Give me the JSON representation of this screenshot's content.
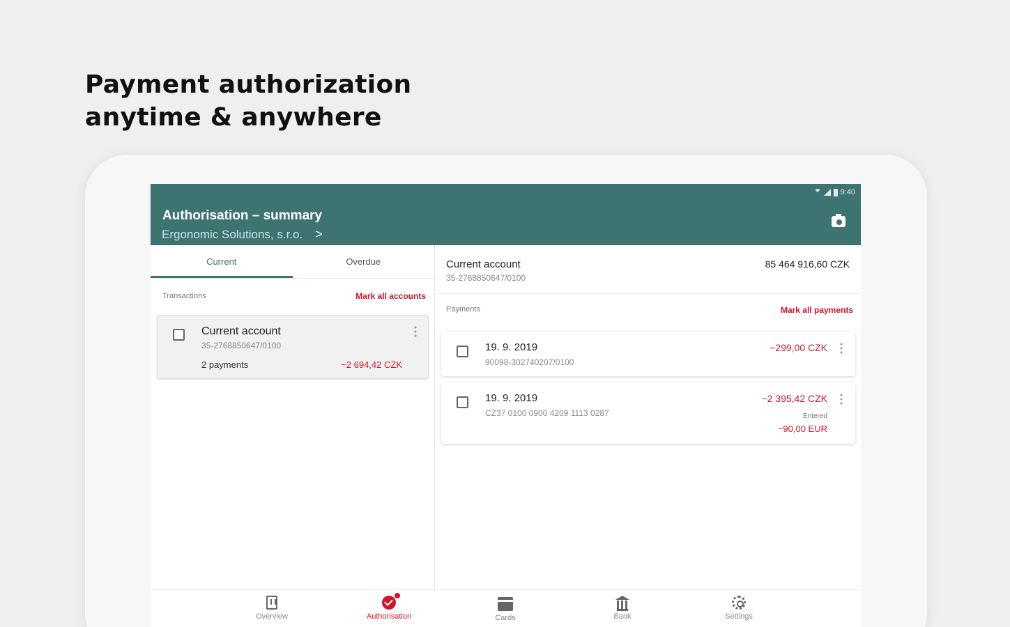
{
  "headline": {
    "line1": "Payment authorization",
    "line2": "anytime & anywhere"
  },
  "status_bar": {
    "time": "9:40"
  },
  "app_bar": {
    "title": "Authorisation – summary",
    "subtitle": "Ergonomic Solutions, s.r.o.",
    "subtitle_chevron": ">"
  },
  "tabs": [
    {
      "label": "Current",
      "active": true
    },
    {
      "label": "Overdue",
      "active": false
    }
  ],
  "left_pane": {
    "section_label": "Transactions",
    "mark_all_label": "Mark all accounts",
    "account": {
      "name": "Current account",
      "number": "35-2768850647/0100",
      "payments": "2 payments",
      "amount": "−2 694,42 CZK"
    }
  },
  "right_pane": {
    "account_name": "Current account",
    "account_number": "35-2768850647/0100",
    "balance": "85 464 916,60 CZK",
    "section_label": "Payments",
    "mark_all_label": "Mark all payments",
    "payments": [
      {
        "date": "19. 9. 2019",
        "reference": "90098-302740207/0100",
        "amount": "−299,00 CZK"
      },
      {
        "date": "19. 9. 2019",
        "reference": "CZ37 0100 0900 4209 1113 0287",
        "amount": "−2 395,42 CZK",
        "entered_label": "Entered",
        "entered_amount": "−90,00 EUR"
      }
    ]
  },
  "bottom_nav": [
    {
      "label": "Overview",
      "icon": "overview-icon",
      "active": false
    },
    {
      "label": "Authorisation",
      "icon": "authorisation-icon",
      "active": true
    },
    {
      "label": "Cards",
      "icon": "card-icon",
      "active": false
    },
    {
      "label": "Bank",
      "icon": "bank-icon",
      "active": false
    },
    {
      "label": "Settings",
      "icon": "settings-icon",
      "active": false
    }
  ],
  "colors": {
    "app_bar": "#3d7371",
    "accent_red": "#d0162d",
    "background": "#efefef"
  }
}
